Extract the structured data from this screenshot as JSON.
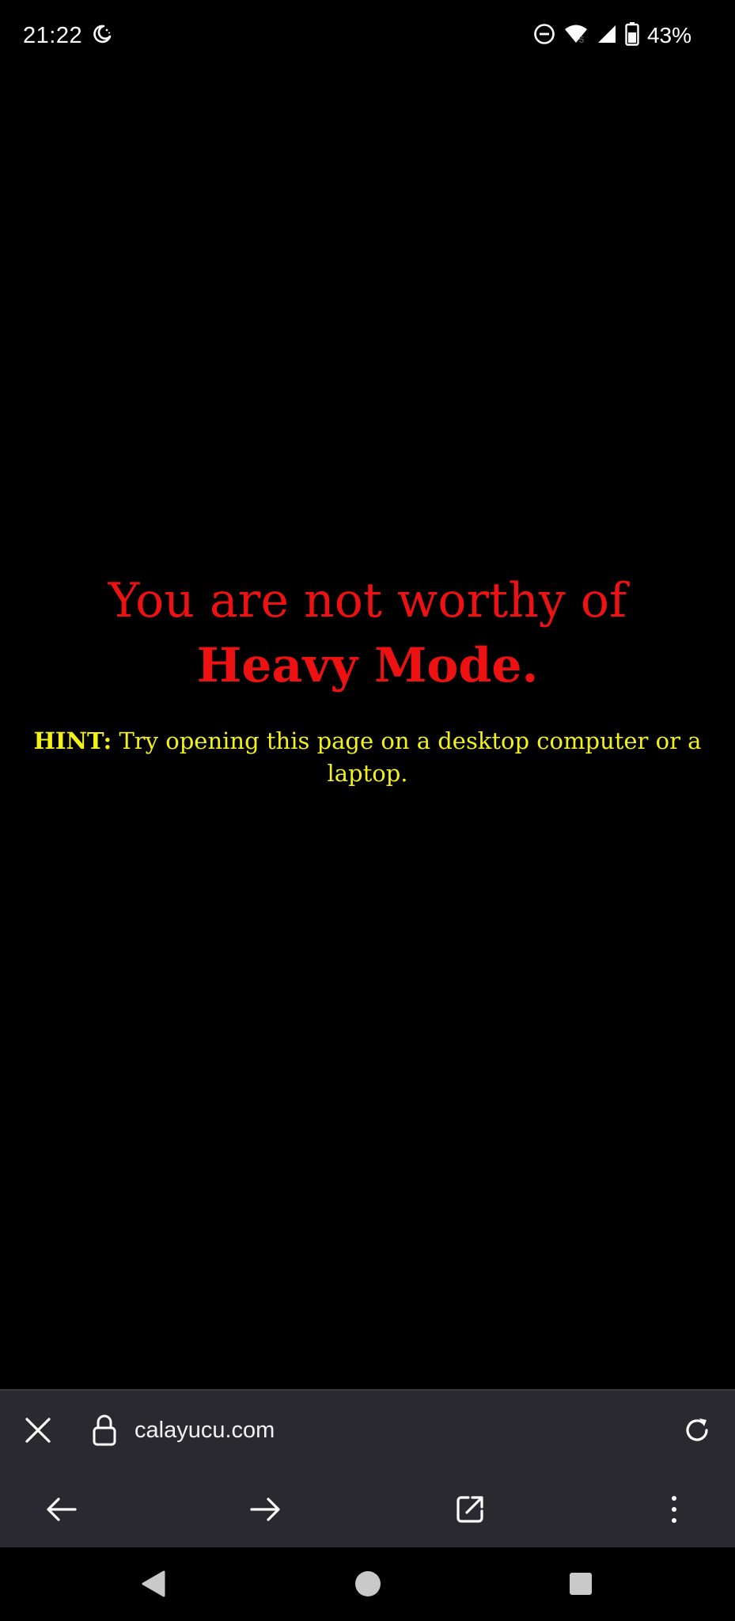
{
  "status_bar": {
    "time": "21:22",
    "battery_percent": "43%",
    "icons": [
      "moon-icon",
      "do-not-disturb-icon",
      "wifi-icon",
      "cell-signal-icon",
      "battery-icon"
    ]
  },
  "page": {
    "headline_prefix": "You are not worthy of ",
    "headline_bold": "Heavy Mode.",
    "hint_label": "HINT:",
    "hint_text": " Try opening this page on a desktop computer or a laptop.",
    "colors": {
      "background": "#000000",
      "headline": "#ee1111",
      "hint": "#f2f21a"
    }
  },
  "browser": {
    "url": "calayucu.com",
    "toolbar_color": "#2a2930",
    "icons": {
      "close": "close-icon",
      "lock": "lock-icon",
      "reload": "reload-icon",
      "back": "arrow-left-icon",
      "forward": "arrow-right-icon",
      "share": "share-icon",
      "menu": "more-vertical-icon"
    }
  },
  "system_nav": {
    "icons": [
      "triangle-back-icon",
      "circle-home-icon",
      "square-recents-icon"
    ]
  }
}
